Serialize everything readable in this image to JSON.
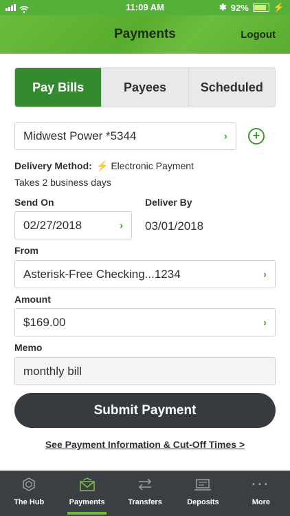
{
  "status": {
    "time": "11:09 AM",
    "battery": "92%"
  },
  "header": {
    "title": "Payments",
    "logout": "Logout"
  },
  "tabs": [
    {
      "label": "Pay Bills",
      "active": true
    },
    {
      "label": "Payees",
      "active": false
    },
    {
      "label": "Scheduled",
      "active": false
    }
  ],
  "payee": {
    "value": "Midwest Power *5344"
  },
  "delivery": {
    "label": "Delivery Method:",
    "method": "Electronic Payment",
    "note": "Takes 2 business days"
  },
  "send_on": {
    "label": "Send On",
    "value": "02/27/2018"
  },
  "deliver_by": {
    "label": "Deliver By",
    "value": "03/01/2018"
  },
  "from": {
    "label": "From",
    "value": "Asterisk-Free Checking...1234"
  },
  "amount": {
    "label": "Amount",
    "value": "$169.00"
  },
  "memo": {
    "label": "Memo",
    "value": "monthly bill"
  },
  "submit_label": "Submit Payment",
  "info_link": "See Payment Information & Cut-Off Times >",
  "bottom_nav": [
    {
      "label": "The Hub",
      "icon": "hub-icon"
    },
    {
      "label": "Payments",
      "icon": "payments-icon",
      "active": true
    },
    {
      "label": "Transfers",
      "icon": "transfers-icon"
    },
    {
      "label": "Deposits",
      "icon": "deposits-icon"
    },
    {
      "label": "More",
      "icon": "more-icon"
    }
  ],
  "colors": {
    "brand_green": "#55b03a",
    "active_tab": "#348a2e",
    "dark": "#373a3f",
    "accent": "#6db83e"
  }
}
